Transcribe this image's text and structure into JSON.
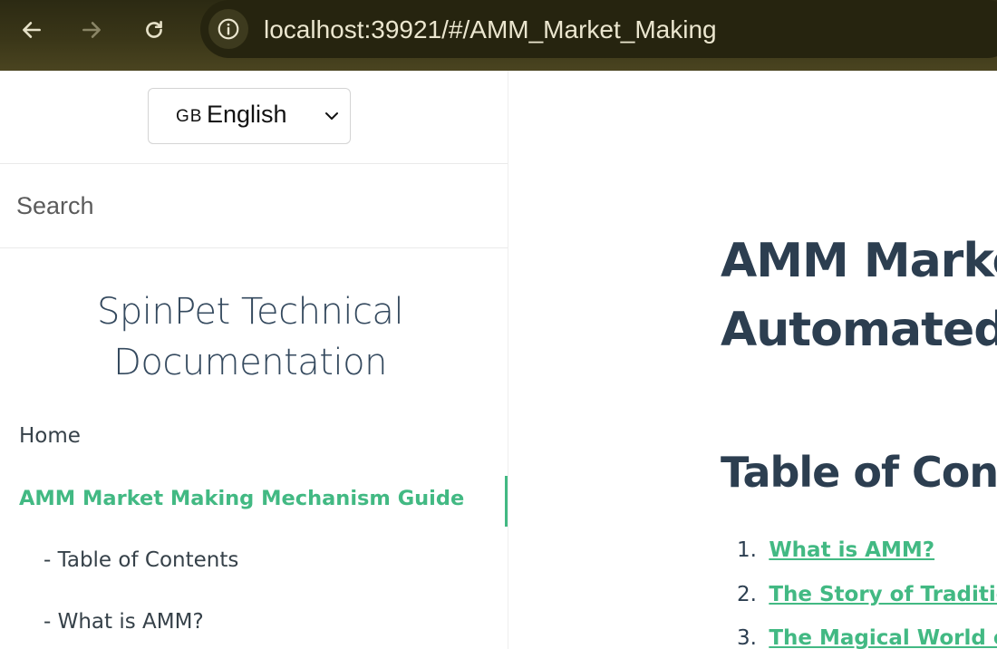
{
  "browser": {
    "url": "localhost:39921/#/AMM_Market_Making"
  },
  "sidebar": {
    "language": {
      "flag": "GB",
      "selected": "English"
    },
    "search": {
      "placeholder": "Search"
    },
    "title_line1": "SpinPet Technical",
    "title_line2": "Documentation",
    "items": [
      {
        "label": "Home"
      },
      {
        "label": "AMM Market Making Mechanism Guide",
        "active": true
      },
      {
        "label": "- Table of Contents"
      },
      {
        "label": "- What is AMM?"
      }
    ]
  },
  "main": {
    "heading_line1": "AMM Market",
    "heading_line2": "Automated",
    "toc_heading": "Table of Conte",
    "toc": [
      {
        "num": "1.",
        "label": "What is AMM?"
      },
      {
        "num": "2.",
        "label": "The Story of Tradition"
      },
      {
        "num": "3.",
        "label": "The Magical World of"
      }
    ]
  },
  "colors": {
    "accent": "#42b983",
    "heading": "#2c3e50",
    "sidebar_text": "#364149",
    "browser_bar": "#3a3618"
  }
}
